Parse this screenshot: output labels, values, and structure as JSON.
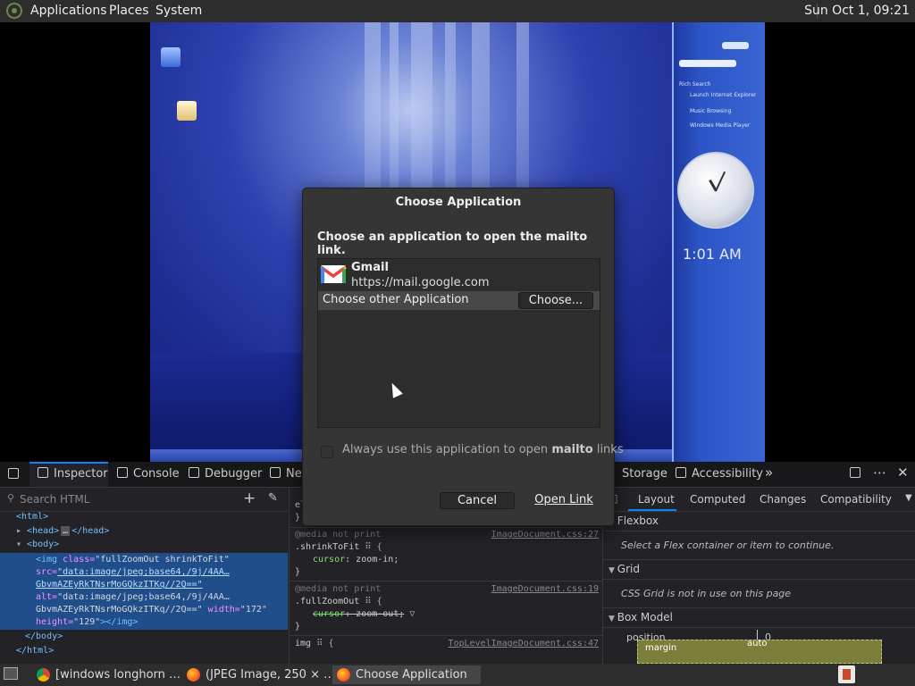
{
  "top_panel": {
    "menus": [
      "Applications",
      "Places",
      "System"
    ],
    "clock": "Sun Oct 1, 09:21"
  },
  "screenshot": {
    "time": "1:01 AM"
  },
  "dialog": {
    "title": "Choose Application",
    "prompt": "Choose an application to open the mailto link.",
    "app_name": "Gmail",
    "app_url": "https://mail.google.com",
    "other_label": "Choose other Application",
    "choose_button": "Choose...",
    "checkbox_label_pre": "Always use this application to open ",
    "checkbox_label_bold": "mailto",
    "checkbox_label_post": " links",
    "checkbox_checked": false,
    "cancel_button": "Cancel",
    "open_button": "Open Link"
  },
  "devtools": {
    "tabs": [
      "Inspector",
      "Console",
      "Debugger",
      "Ne",
      "Storage",
      "Accessibility"
    ],
    "search_placeholder": "Search HTML",
    "markup": {
      "html_open": "<html>",
      "head": "<head>",
      "head_close": "</head>",
      "body_open": "<body>",
      "img_line1_tag": "<img",
      "img_class_attr": "class=",
      "img_class_val": "\"fullZoomOut shrinkToFit\"",
      "img_src_attr": "src=",
      "img_src_val": "\"data:image/jpeg;base64,/9j/4AA…",
      "img_src_cont": "GbvmAZEyRkTNsrMoGQkzITKq//2Q==\"",
      "img_alt_attr": "alt=",
      "img_alt_val": "\"data:image/jpeg;base64,/9j/4AA…",
      "img_alt_cont": "GbvmAZEyRkTNsrMoGQkzITKq//2Q==\"",
      "img_width_attr": "width=",
      "img_width_val": "\"172\"",
      "img_height_attr": "height=",
      "img_height_val": "\"129\"",
      "img_close": "></img>",
      "body_close": "</body>",
      "html_close": "</html>"
    },
    "rules": {
      "r0": "el",
      "r0b": "}",
      "media1": "@media not print",
      "src1": "ImageDocument.css:27",
      "sel1": ".shrinkToFit",
      "prop1_name": "cursor",
      "prop1_val": "zoom-in;",
      "close1": "}",
      "media2": "@media not print",
      "src2": "ImageDocument.css:19",
      "sel2": ".fullZoomOut",
      "prop2_name": "cursor",
      "prop2_val": "zoom-out;",
      "close2": "}",
      "sel3": "img",
      "src3": "TopLevelImageDocument.css:47"
    },
    "layout_tabs": [
      "Layout",
      "Computed",
      "Changes",
      "Compatibility"
    ],
    "flexbox_header": "Flexbox",
    "flexbox_note": "Select a Flex container or item to continue.",
    "grid_header": "Grid",
    "grid_note": "CSS Grid is not in use on this page",
    "boxmodel_header": "Box Model",
    "position_label": "position",
    "position_value": "0",
    "margin_label": "margin",
    "margin_value": "auto"
  },
  "taskbar": {
    "tasks": [
      "[windows longhorn …",
      "(JPEG Image, 250 × …",
      "Choose Application"
    ]
  }
}
